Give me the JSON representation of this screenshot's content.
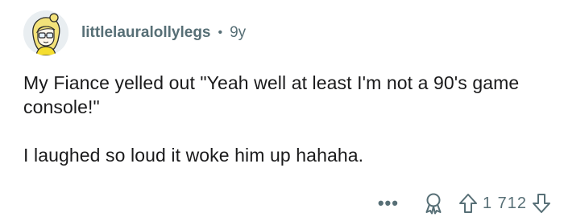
{
  "comment": {
    "username": "littlelauralollylegs",
    "separator": "•",
    "age": "9y",
    "paragraphs": [
      "My Fiance yelled out \"Yeah well at least I'm not a 90's game console!\"",
      "I laughed so loud it woke him up hahaha."
    ],
    "actions": {
      "more_label": "•••",
      "score": "1 712"
    }
  },
  "colors": {
    "meta_text": "#576f76",
    "body_text": "#1a1a1b",
    "background": "#ffffff"
  },
  "icons": [
    "avatar",
    "award-icon",
    "upvote-icon",
    "downvote-icon",
    "more-icon"
  ]
}
